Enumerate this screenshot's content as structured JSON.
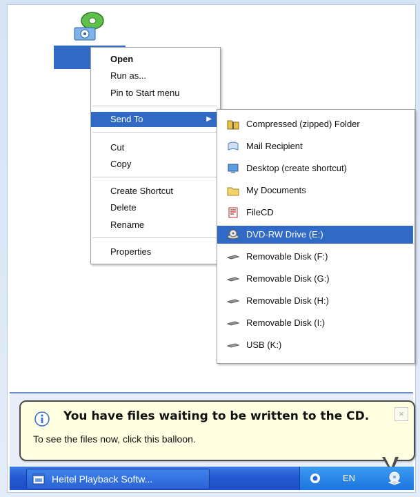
{
  "context_menu": {
    "items": [
      {
        "label": "Open"
      },
      {
        "label": "Run as..."
      },
      {
        "label": "Pin to Start menu"
      },
      {
        "label": "Send To"
      },
      {
        "label": "Cut"
      },
      {
        "label": "Copy"
      },
      {
        "label": "Create Shortcut"
      },
      {
        "label": "Delete"
      },
      {
        "label": "Rename"
      },
      {
        "label": "Properties"
      }
    ]
  },
  "send_to_menu": {
    "items": [
      {
        "label": "Compressed (zipped) Folder",
        "icon": "zip-folder-icon"
      },
      {
        "label": "Mail Recipient",
        "icon": "mail-icon"
      },
      {
        "label": "Desktop (create shortcut)",
        "icon": "desktop-icon"
      },
      {
        "label": "My Documents",
        "icon": "folder-icon"
      },
      {
        "label": "FileCD",
        "icon": "filecd-icon"
      },
      {
        "label": "DVD-RW Drive (E:)",
        "icon": "dvd-drive-icon"
      },
      {
        "label": "Removable Disk (F:)",
        "icon": "removable-disk-icon"
      },
      {
        "label": "Removable Disk (G:)",
        "icon": "removable-disk-icon"
      },
      {
        "label": "Removable Disk (H:)",
        "icon": "removable-disk-icon"
      },
      {
        "label": "Removable Disk (I:)",
        "icon": "removable-disk-icon"
      },
      {
        "label": "USB (K:)",
        "icon": "usb-disk-icon"
      }
    ]
  },
  "balloon": {
    "title": "You have files waiting to be written to the CD.",
    "body": "To see the files now, click this balloon.",
    "close": "×"
  },
  "taskbar": {
    "task_label": "Heitel Playback Softw...",
    "language": "EN"
  },
  "colors": {
    "selection": "#316ac5",
    "balloon_bg": "#ffffe1",
    "taskbar": "#2458d1"
  }
}
